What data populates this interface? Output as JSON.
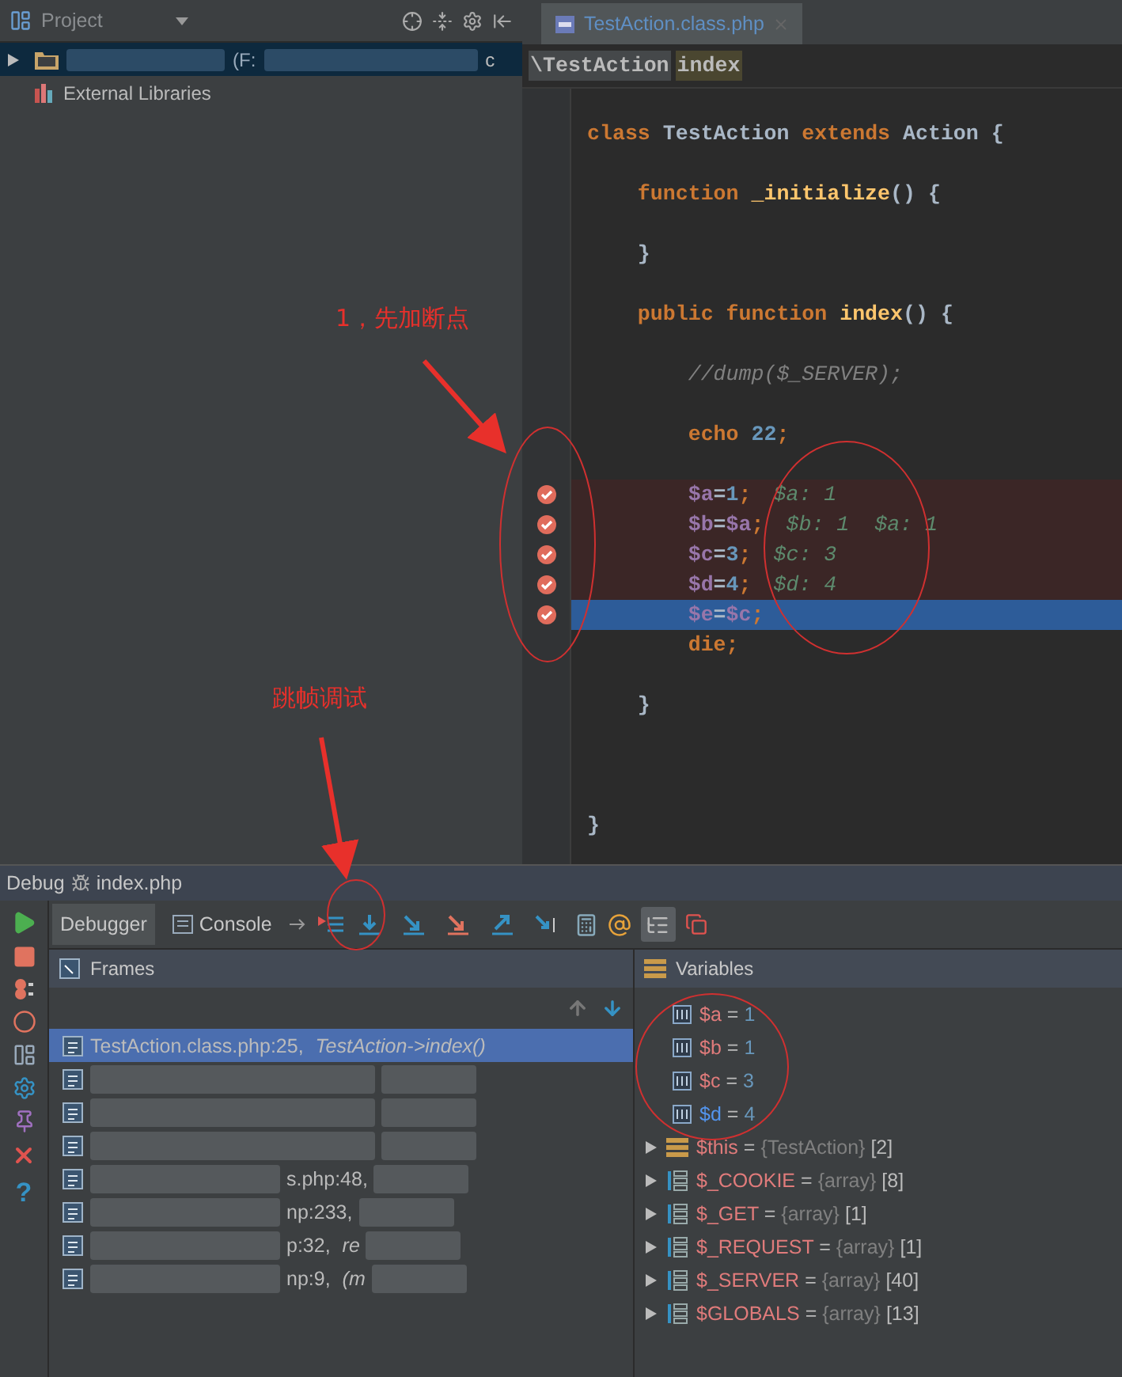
{
  "project": {
    "title": "Project",
    "tree": [
      {
        "kind": "project",
        "label": "(F:",
        "tail": "c",
        "selected": true,
        "expanded": false
      },
      {
        "kind": "libraries",
        "label": "External Libraries",
        "selected": false
      }
    ]
  },
  "editor": {
    "tabs": [
      {
        "label": "TestAction.class.php",
        "selected": true
      }
    ],
    "breadcrumbs": [
      "\\TestAction",
      "index"
    ],
    "lines": [
      {
        "kind": "code",
        "breakpoint": false,
        "current": false,
        "tokens": [
          {
            "kind": "keyword",
            "t": "class "
          },
          {
            "kind": "classname",
            "t": "TestAction"
          },
          {
            "kind": "keyword",
            "t": " extends "
          },
          {
            "kind": "classname",
            "t": "Action"
          },
          {
            "kind": "plain",
            "t": " {"
          }
        ]
      },
      {
        "kind": "blank"
      },
      {
        "kind": "code",
        "breakpoint": false,
        "current": false,
        "tokens": [
          {
            "kind": "keyword",
            "t": "    function "
          },
          {
            "kind": "function",
            "t": "_initialize"
          },
          {
            "kind": "plain",
            "t": "() {"
          }
        ]
      },
      {
        "kind": "blank"
      },
      {
        "kind": "code",
        "breakpoint": false,
        "current": false,
        "tokens": [
          {
            "kind": "plain",
            "t": "    }"
          }
        ]
      },
      {
        "kind": "blank"
      },
      {
        "kind": "code",
        "breakpoint": false,
        "current": false,
        "tokens": [
          {
            "kind": "keyword",
            "t": "    public function "
          },
          {
            "kind": "function",
            "t": "index"
          },
          {
            "kind": "plain",
            "t": "() {"
          }
        ]
      },
      {
        "kind": "blank"
      },
      {
        "kind": "code",
        "breakpoint": false,
        "current": false,
        "tokens": [
          {
            "kind": "comment",
            "t": "        //dump($_SERVER);"
          }
        ]
      },
      {
        "kind": "blank"
      },
      {
        "kind": "code",
        "breakpoint": false,
        "current": false,
        "tokens": [
          {
            "kind": "keyword",
            "t": "        echo "
          },
          {
            "kind": "number",
            "t": "22"
          },
          {
            "kind": "keyword",
            "t": ";"
          }
        ]
      },
      {
        "kind": "blank"
      },
      {
        "kind": "code",
        "breakpoint": true,
        "current": false,
        "hint": "$a: 1",
        "tokens": [
          {
            "kind": "variable",
            "t": "        $a"
          },
          {
            "kind": "plain",
            "t": "="
          },
          {
            "kind": "number",
            "t": "1"
          },
          {
            "kind": "keyword",
            "t": ";"
          }
        ]
      },
      {
        "kind": "code",
        "breakpoint": true,
        "current": false,
        "hint": "$b: 1  $a: 1",
        "tokens": [
          {
            "kind": "variable",
            "t": "        $b"
          },
          {
            "kind": "plain",
            "t": "="
          },
          {
            "kind": "variable",
            "t": "$a"
          },
          {
            "kind": "keyword",
            "t": ";"
          }
        ]
      },
      {
        "kind": "code",
        "breakpoint": true,
        "current": false,
        "hint": "$c: 3",
        "tokens": [
          {
            "kind": "variable",
            "t": "        $c"
          },
          {
            "kind": "plain",
            "t": "="
          },
          {
            "kind": "number",
            "t": "3"
          },
          {
            "kind": "keyword",
            "t": ";"
          }
        ]
      },
      {
        "kind": "code",
        "breakpoint": true,
        "current": false,
        "hint": "$d: 4",
        "tokens": [
          {
            "kind": "variable",
            "t": "        $d"
          },
          {
            "kind": "plain",
            "t": "="
          },
          {
            "kind": "number",
            "t": "4"
          },
          {
            "kind": "keyword",
            "t": ";"
          }
        ]
      },
      {
        "kind": "code",
        "breakpoint": true,
        "current": true,
        "tokens": [
          {
            "kind": "variable",
            "t": "        $e"
          },
          {
            "kind": "plain",
            "t": "="
          },
          {
            "kind": "variable",
            "t": "$c"
          },
          {
            "kind": "keyword",
            "t": ";"
          }
        ]
      },
      {
        "kind": "code",
        "breakpoint": false,
        "current": false,
        "tokens": [
          {
            "kind": "keyword",
            "t": "        die;"
          }
        ]
      },
      {
        "kind": "blank"
      },
      {
        "kind": "code",
        "breakpoint": false,
        "current": false,
        "tokens": [
          {
            "kind": "plain",
            "t": "    }"
          }
        ]
      },
      {
        "kind": "blank"
      },
      {
        "kind": "blank"
      },
      {
        "kind": "blank"
      },
      {
        "kind": "code",
        "breakpoint": false,
        "current": false,
        "tokens": [
          {
            "kind": "plain",
            "t": "}"
          }
        ]
      }
    ]
  },
  "debug": {
    "title": "Debug",
    "config": "index.php",
    "help": "?",
    "tabs": [
      {
        "label": "Debugger",
        "selected": true
      },
      {
        "label": "Console",
        "selected": false
      }
    ],
    "frames_title": "Frames",
    "frames": [
      {
        "file": "TestAction.class.php:25, ",
        "method": "TestAction->index()",
        "selected": true,
        "redacted": false
      },
      {
        "selected": false,
        "redacted": true
      },
      {
        "selected": false,
        "redacted": true
      },
      {
        "selected": false,
        "redacted": true
      },
      {
        "file": "s.php:48,",
        "selected": false,
        "redacted": true
      },
      {
        "file": "np:233,",
        "selected": false,
        "redacted": true
      },
      {
        "file": "p:32, ",
        "method": "re",
        "selected": false,
        "redacted": true
      },
      {
        "file": "np:9, ",
        "method": "(m",
        "selected": false,
        "redacted": true
      }
    ],
    "variables_title": "Variables",
    "variables": [
      {
        "kind": "scalar",
        "name": "$a",
        "operator": "=",
        "value": "1",
        "changed": false
      },
      {
        "kind": "scalar",
        "name": "$b",
        "operator": "=",
        "value": "1",
        "changed": false
      },
      {
        "kind": "scalar",
        "name": "$c",
        "operator": "=",
        "value": "3",
        "changed": false
      },
      {
        "kind": "scalar",
        "name": "$d",
        "operator": "=",
        "value": "4",
        "changed": true
      },
      {
        "kind": "object",
        "name": "$this",
        "operator": "=",
        "type": "{TestAction}",
        "count": "[2]"
      },
      {
        "kind": "array",
        "name": "$_COOKIE",
        "operator": "=",
        "type": "{array}",
        "count": "[8]"
      },
      {
        "kind": "array",
        "name": "$_GET",
        "operator": "=",
        "type": "{array}",
        "count": "[1]"
      },
      {
        "kind": "array",
        "name": "$_REQUEST",
        "operator": "=",
        "type": "{array}",
        "count": "[1]"
      },
      {
        "kind": "array",
        "name": "$_SERVER",
        "operator": "=",
        "type": "{array}",
        "count": "[40]"
      },
      {
        "kind": "array",
        "name": "$GLOBALS",
        "operator": "=",
        "type": "{array}",
        "count": "[13]"
      }
    ]
  },
  "annotations": [
    {
      "text": "1，先加断点"
    },
    {
      "text": "跳帧调试"
    }
  ]
}
